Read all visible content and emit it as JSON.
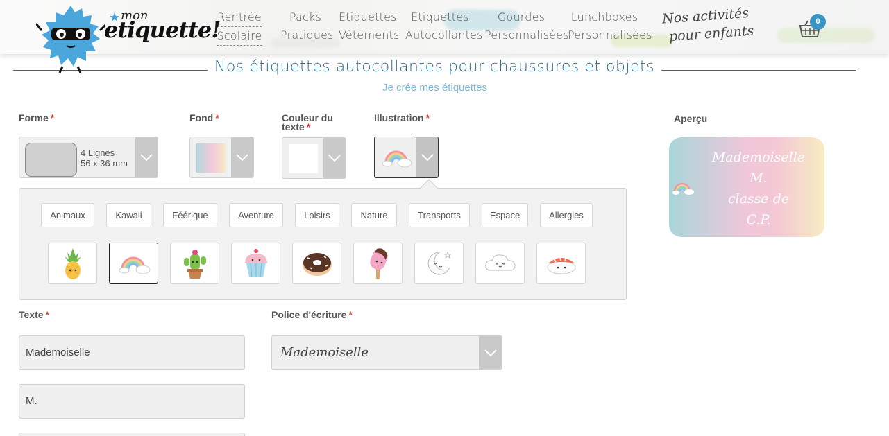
{
  "header": {
    "logo": {
      "mon": "mon",
      "etiquette": "etiquette!"
    },
    "nav": [
      {
        "line1": "Rentrée",
        "line2": "Scolaire"
      },
      {
        "line1": "Packs",
        "line2": "Pratiques"
      },
      {
        "line1": "Etiquettes",
        "line2": "Vêtements"
      },
      {
        "line1": "Etiquettes",
        "line2": "Autocollantes"
      },
      {
        "line1": "Gourdes",
        "line2": "Personnalisées"
      },
      {
        "line1": "Lunchboxes",
        "line2": "Personnalisées"
      }
    ],
    "special": {
      "line1": "Nos activités",
      "line2": "pour enfants"
    },
    "cart_count": "0"
  },
  "page": {
    "title": "Nos étiquettes autocollantes pour chaussures et objets",
    "subtitle": "Je crée mes étiquettes"
  },
  "form": {
    "forme": {
      "label": "Forme",
      "req": "*",
      "line1": "4 Lignes",
      "line2": "56 x 36 mm"
    },
    "fond": {
      "label": "Fond",
      "req": "*"
    },
    "couleur": {
      "label_line1": "Couleur du",
      "label_line2": "texte",
      "req": "*",
      "value": "#ffffff"
    },
    "illustration": {
      "label": "Illustration",
      "req": "*"
    },
    "categories": [
      "Animaux",
      "Kawaii",
      "Féérique",
      "Aventure",
      "Loisirs",
      "Nature",
      "Transports",
      "Espace",
      "Allergies"
    ],
    "illustrations": [
      "pineapple-icon",
      "rainbow-icon",
      "cactus-icon",
      "cupcake-icon",
      "donut-icon",
      "popsicle-icon",
      "moon-icon",
      "cloud-icon",
      "sushi-icon"
    ],
    "selected_illustration": "rainbow-icon",
    "texte": {
      "label": "Texte",
      "req": "*",
      "lines": [
        "Mademoiselle",
        "M."
      ]
    },
    "police": {
      "label": "Police d'écriture",
      "req": "*",
      "value": "Mademoiselle"
    }
  },
  "preview": {
    "label": "Aperçu",
    "lines": [
      "Mademoiselle",
      "M.",
      "classe de",
      "C.P."
    ]
  },
  "colors": {
    "accent": "#2b6d8f",
    "subtitle": "#7cb9d6",
    "required": "#d13b3b",
    "badge": "#3a95c4"
  }
}
